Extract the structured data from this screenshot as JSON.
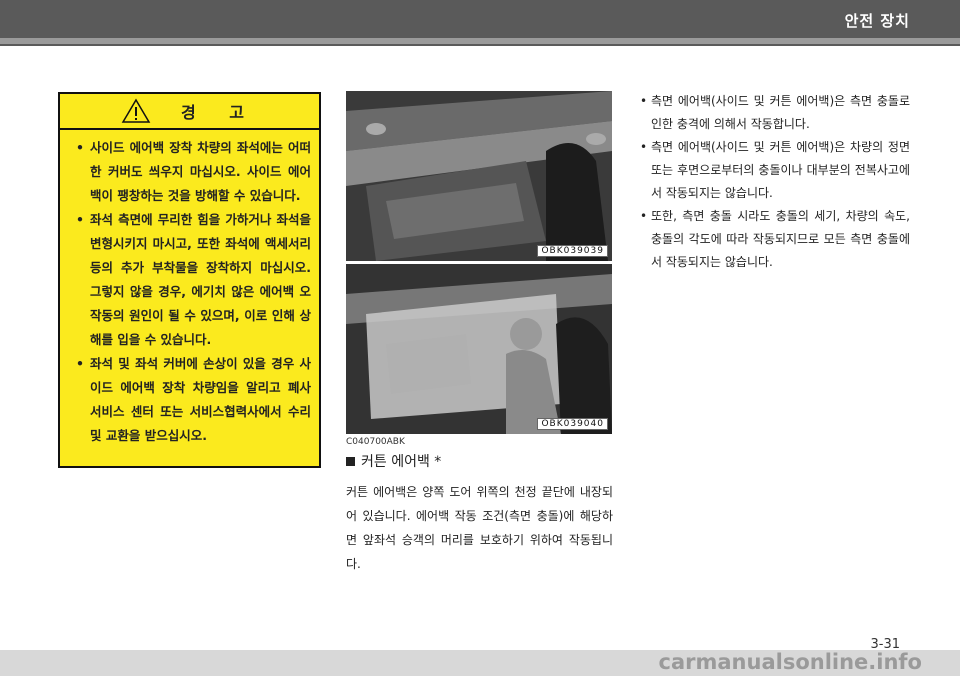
{
  "header": {
    "title": "안전 장치"
  },
  "warning": {
    "title": "경  고",
    "items": [
      "사이드 에어백 장착 차량의 좌석에는 어떠한 커버도 씌우지 마십시오. 사이드 에어백이 팽창하는 것을 방해할 수 있습니다.",
      "좌석 측면에 무리한 힘을 가하거나 좌석을 변형시키지 마시고, 또한 좌석에 액세서리 등의 추가 부착물을 장착하지 마십시오. 그렇지 않을 경우, 에기치 않은 에어백 오작동의 원인이 될 수 있으며, 이로 인해 상해를 입을 수 있습니다.",
      "좌석 및 좌석 커버에 손상이 있을 경우 사이드 에어백 장착 차량임을 알리고 폐사 서비스 센터 또는 서비스협력사에서 수리 및 교환을 받으십시오."
    ]
  },
  "figures": [
    {
      "code": "OBK039039"
    },
    {
      "code": "OBK039040"
    }
  ],
  "caption_code": "C040700ABK",
  "section": {
    "title": "커튼 에어백 *",
    "body": "커튼 에어백은 양쪽 도어 위쪽의 천정 끝단에 내장되어 있습니다. 에어백 작동 조건(측면 충돌)에 해당하면 앞좌석 승객의 머리를 보호하기 위하여 작동됩니다."
  },
  "right_items": [
    "측면 에어백(사이드 및 커튼 에어백)은 측면 충돌로 인한 충격에 의해서 작동합니다.",
    "측면 에어백(사이드 및 커튼 에어백)은 차량의 정면 또는 후면으로부터의 충돌이나 대부분의 전복사고에서 작동되지는 않습니다.",
    "또한, 측면 충돌 시라도 충돌의 세기, 차량의 속도, 충돌의 각도에 따라 작동되지므로 모든 측면 충돌에서 작동되지는 않습니다."
  ],
  "page_number": "3-31",
  "watermark": "carmanualsonline.info",
  "colors": {
    "warning_bg": "#fbea1e",
    "header_bg": "#5a5a5a"
  }
}
